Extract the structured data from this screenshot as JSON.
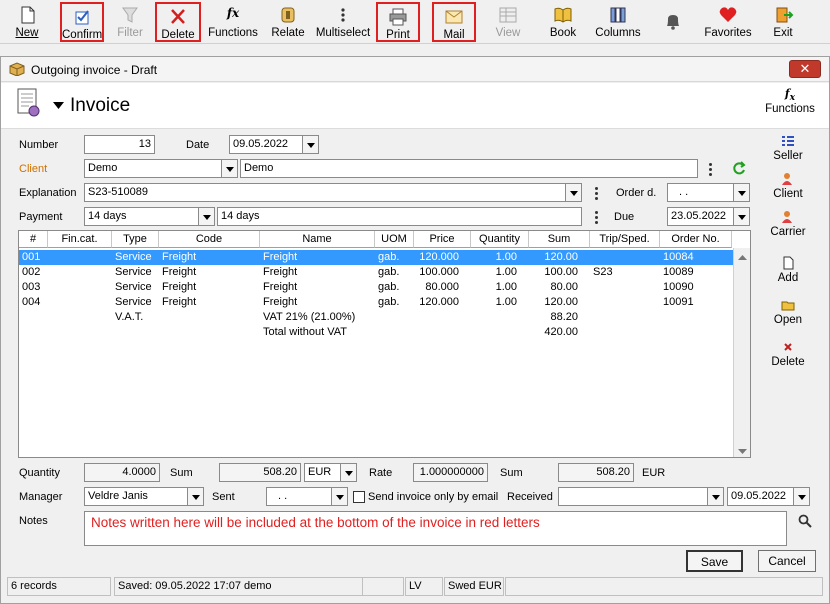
{
  "toolbar": {
    "new": "New",
    "confirm": "Confirm",
    "filter": "Filter",
    "delete": "Delete",
    "functions": "Functions",
    "relate": "Relate",
    "multiselect": "Multiselect",
    "print": "Print",
    "mail": "Mail",
    "view": "View",
    "book": "Book",
    "columns": "Columns",
    "favorites": "Favorites",
    "exit": "Exit"
  },
  "window": {
    "title": "Outgoing invoice  - Draft",
    "close": "✕"
  },
  "header": {
    "title": "Invoice",
    "functions_label": "Functions"
  },
  "form": {
    "number_label": "Number",
    "number": "13",
    "date_label": "Date",
    "date": "09.05.2022",
    "client_label": "Client",
    "client_code": "Demo",
    "client_name": "Demo",
    "explanation_label": "Explanation",
    "explanation": "S23-510089",
    "order_d_label": "Order d.",
    "order_d": ". .",
    "payment_label": "Payment",
    "payment_code": "14 days",
    "payment_name": "14 days",
    "due_label": "Due",
    "due": "23.05.2022"
  },
  "grid": {
    "columns": [
      "#",
      "Fin.cat.",
      "Type",
      "Code",
      "Name",
      "UOM",
      "Price",
      "Quantity",
      "Sum",
      "Trip/Sped.",
      "Order No."
    ],
    "rows": [
      {
        "no": "001",
        "fincat": "",
        "type": "Service",
        "code": "Freight",
        "name": "Freight",
        "uom": "gab.",
        "price": "120.000",
        "qty": "1.00",
        "sum": "120.00",
        "trip": "",
        "order": "10084"
      },
      {
        "no": "002",
        "fincat": "",
        "type": "Service",
        "code": "Freight",
        "name": "Freight",
        "uom": "gab.",
        "price": "100.000",
        "qty": "1.00",
        "sum": "100.00",
        "trip": "S23",
        "order": "10089"
      },
      {
        "no": "003",
        "fincat": "",
        "type": "Service",
        "code": "Freight",
        "name": "Freight",
        "uom": "gab.",
        "price": "80.000",
        "qty": "1.00",
        "sum": "80.00",
        "trip": "",
        "order": "10090"
      },
      {
        "no": "004",
        "fincat": "",
        "type": "Service",
        "code": "Freight",
        "name": "Freight",
        "uom": "gab.",
        "price": "120.000",
        "qty": "1.00",
        "sum": "120.00",
        "trip": "",
        "order": "10091"
      },
      {
        "no": "",
        "fincat": "",
        "type": "V.A.T.",
        "code": "",
        "name": "VAT 21% (21.00%)",
        "uom": "",
        "price": "",
        "qty": "",
        "sum": "88.20",
        "trip": "",
        "order": ""
      },
      {
        "no": "",
        "fincat": "",
        "type": "",
        "code": "",
        "name": "Total without VAT",
        "uom": "",
        "price": "",
        "qty": "",
        "sum": "420.00",
        "trip": "",
        "order": ""
      }
    ]
  },
  "side": {
    "seller": "Seller",
    "client": "Client",
    "carrier": "Carrier",
    "add": "Add",
    "open": "Open",
    "delete": "Delete"
  },
  "footer": {
    "quantity_label": "Quantity",
    "quantity": "4.0000",
    "sum_label": "Sum",
    "sum": "508.20",
    "currency": "EUR",
    "rate_label": "Rate",
    "rate": "1.000000000",
    "sum2_label": "Sum",
    "sum2": "508.20",
    "currency2": "EUR",
    "manager_label": "Manager",
    "manager": "Veldre Janis",
    "sent_label": "Sent",
    "sent": ". .",
    "mail_only_label": "Send invoice only by email",
    "received_label": "Received",
    "received_date": "09.05.2022",
    "notes_label": "Notes",
    "notes": "Notes written here will be included at the bottom of the invoice in red letters",
    "notes_color": "#e02020",
    "save": "Save",
    "cancel": "Cancel"
  },
  "status": {
    "records": "6 records",
    "saved": "Saved: 09.05.2022 17:07 demo",
    "lang": "LV",
    "currency": "Swed EUR"
  },
  "colors": {
    "selection": "#3399ff",
    "highlight_box": "#e02020",
    "client_label": "#d07000"
  }
}
